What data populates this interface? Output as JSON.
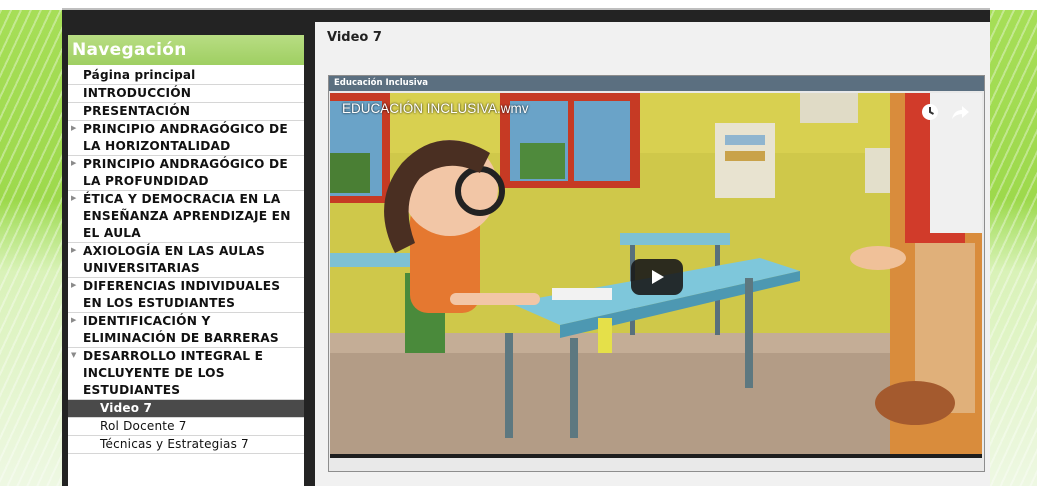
{
  "sidebar": {
    "title": "Navegación",
    "items": [
      {
        "label": "Página principal",
        "type": "home"
      },
      {
        "label": "INTRODUCCIÓN",
        "type": "leaf"
      },
      {
        "label": "PRESENTACIÓN",
        "type": "leaf"
      },
      {
        "label": "PRINCIPIO ANDRAGÓGICO DE LA HORIZONTALIDAD",
        "type": "collapsed"
      },
      {
        "label": "PRINCIPIO ANDRAGÓGICO DE LA PROFUNDIDAD",
        "type": "collapsed"
      },
      {
        "label": "ÉTICA Y DEMOCRACIA EN LA ENSEÑANZA APRENDIZAJE EN EL AULA",
        "type": "collapsed"
      },
      {
        "label": "AXIOLOGÍA EN LAS AULAS UNIVERSITARIAS",
        "type": "collapsed"
      },
      {
        "label": "DIFERENCIAS INDIVIDUALES EN LOS ESTUDIANTES",
        "type": "collapsed"
      },
      {
        "label": "IDENTIFICACIÓN Y ELIMINACIÓN DE BARRERAS",
        "type": "collapsed"
      },
      {
        "label": "DESARROLLO INTEGRAL E INCLUYENTE DE LOS ESTUDIANTES",
        "type": "expanded"
      },
      {
        "label": "Video 7",
        "type": "sub-active"
      },
      {
        "label": "Rol Docente 7",
        "type": "sub"
      },
      {
        "label": "Técnicas y Estrategias 7",
        "type": "sub"
      }
    ]
  },
  "main": {
    "title": "Video 7",
    "panel_title": "Educación Inclusiva",
    "video": {
      "title": "EDUCACIÓN INCLUSIVA.wmv",
      "icons": [
        "clock-icon",
        "share-icon",
        "play-icon"
      ]
    }
  },
  "colors": {
    "nav_header": "#a9d46d",
    "panel_header": "#5b6f80",
    "active_item": "#4a4a4a",
    "page_bg_green": "#a6de57"
  }
}
